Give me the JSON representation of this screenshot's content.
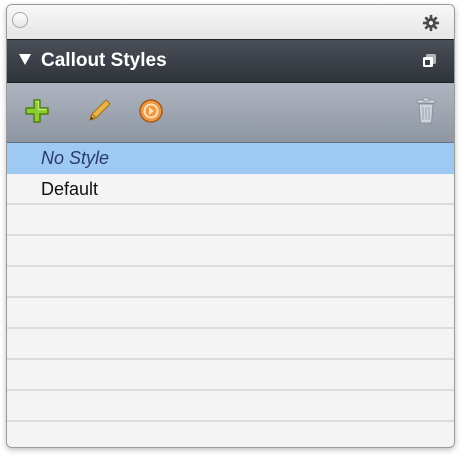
{
  "panel": {
    "title": "Callout Styles"
  },
  "toolbar": {
    "buttons": [
      {
        "name": "add-style",
        "icon": "plus-icon",
        "color": "#7fbf2a"
      },
      {
        "name": "edit-style",
        "icon": "pencil-icon",
        "color": "#e0a23a"
      },
      {
        "name": "duplicate-style",
        "icon": "duplicate-icon",
        "color": "#e08a3a"
      },
      {
        "name": "delete-style",
        "icon": "trash-icon",
        "color": "#c9ced6"
      }
    ]
  },
  "styles": {
    "items": [
      {
        "label": "No Style",
        "selected": true
      },
      {
        "label": "Default",
        "selected": false
      }
    ]
  },
  "colors": {
    "header": "#3a3e45",
    "toolbar": "#9aa1ad",
    "selection": "#9ec9f2"
  }
}
